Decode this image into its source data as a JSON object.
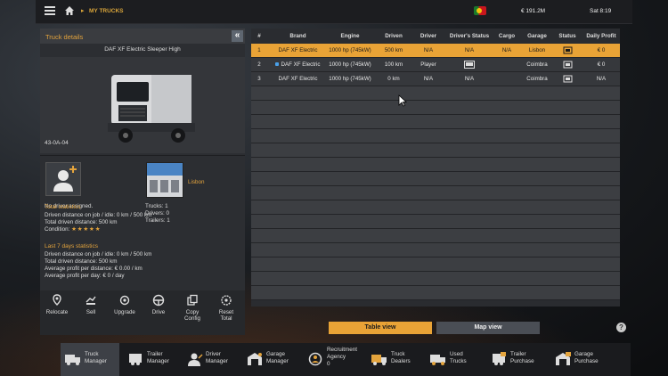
{
  "topbar": {
    "breadcrumb": "MY TRUCKS",
    "money": "€ 191.2M",
    "clock": "Sat 8:19"
  },
  "details": {
    "title": "Truck details",
    "truck_name": "DAF XF Electric Sleeper High",
    "plate": "43-0A-04",
    "no_driver": "No driver assigned.",
    "garage_name": "Lisbon",
    "garage_trucks": "Trucks: 1",
    "garage_drivers": "Drivers: 0",
    "garage_trailers": "Trailers: 1",
    "total_title": "Total statistics",
    "total_lines": [
      "Driven distance on job / idle: 0 km / 500 km",
      "Total driven distance: 500 km"
    ],
    "condition_label": "Condition:",
    "condition_stars": "★★★★★",
    "last7_title": "Last 7 days statistics",
    "last7_lines": [
      "Driven distance on job / idle: 0 km / 500 km",
      "Total driven distance: 500 km",
      "Average profit per distance: € 0.00 / km",
      "Average profit per day: € 0 / day"
    ],
    "actions": [
      "Relocate",
      "Sell",
      "Upgrade",
      "Drive",
      "Copy\nConfig",
      "Reset\nTotal"
    ]
  },
  "table": {
    "headers": [
      "#",
      "Brand",
      "Engine",
      "Driven",
      "Driver",
      "Driver's Status",
      "Cargo",
      "Garage",
      "Status",
      "Daily Profit"
    ],
    "rows": [
      {
        "num": "1",
        "brand": "DAF XF Electric",
        "engine": "1000 hp (745kW)",
        "driven": "500 km",
        "driver": "N/A",
        "dstatus": "N/A",
        "cargo": "N/A",
        "garage": "Lisbon",
        "profit": "€ 0"
      },
      {
        "num": "2",
        "brand": "DAF XF Electric",
        "engine": "1000 hp (745kW)",
        "driven": "100 km",
        "driver": "Player",
        "dstatus": "",
        "cargo": "",
        "garage": "Coimbra",
        "profit": "€ 0"
      },
      {
        "num": "3",
        "brand": "DAF XF Electric",
        "engine": "1000 hp (745kW)",
        "driven": "0 km",
        "driver": "N/A",
        "dstatus": "N/A",
        "cargo": "",
        "garage": "Coimbra",
        "profit": "N/A"
      }
    ]
  },
  "views": {
    "table": "Table view",
    "map": "Map view",
    "help": "?"
  },
  "nav": [
    {
      "label": "Truck\nManager",
      "icon": "truck-icon"
    },
    {
      "label": "Trailer\nManager",
      "icon": "trailer-icon"
    },
    {
      "label": "Driver\nManager",
      "icon": "driver-icon"
    },
    {
      "label": "Garage\nManager",
      "icon": "garage-icon"
    },
    {
      "label": "Recruitment\nAgency\n0",
      "icon": "recruitment-icon"
    },
    {
      "label": "Truck\nDealers",
      "icon": "truck-dealer-icon"
    },
    {
      "label": "Used\nTrucks",
      "icon": "used-truck-icon"
    },
    {
      "label": "Trailer\nPurchase",
      "icon": "trailer-purchase-icon"
    },
    {
      "label": "Garage\nPurchase",
      "icon": "garage-purchase-icon"
    }
  ],
  "colors": {
    "accent": "#e9a336",
    "panel": "#2c2e32",
    "selected_row": "#e9a336"
  }
}
